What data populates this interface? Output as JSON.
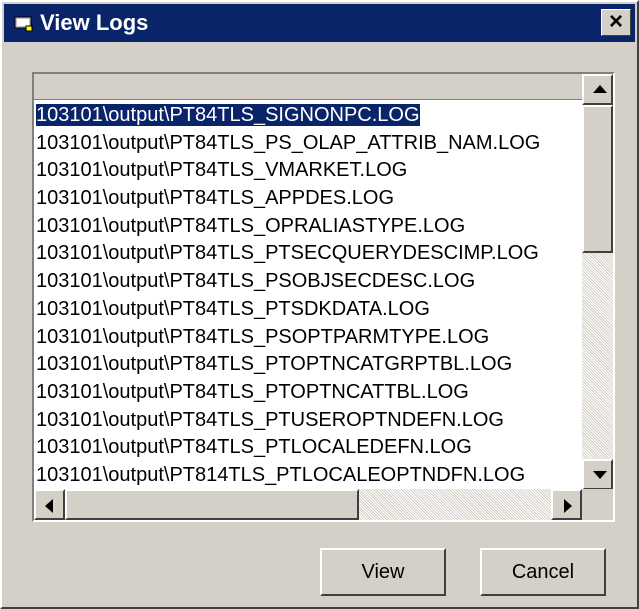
{
  "window": {
    "title": "View Logs",
    "close_label": "×"
  },
  "log_list": {
    "header": "",
    "items": [
      "103101\\output\\PT84TLS_SIGNONPC.LOG",
      "103101\\output\\PT84TLS_PS_OLAP_ATTRIB_NAM.LOG",
      "103101\\output\\PT84TLS_VMARKET.LOG",
      "103101\\output\\PT84TLS_APPDES.LOG",
      "103101\\output\\PT84TLS_OPRALIASTYPE.LOG",
      "103101\\output\\PT84TLS_PTSECQUERYDESCIMP.LOG",
      "103101\\output\\PT84TLS_PSOBJSECDESC.LOG",
      "103101\\output\\PT84TLS_PTSDKDATA.LOG",
      "103101\\output\\PT84TLS_PSOPTPARMTYPE.LOG",
      "103101\\output\\PT84TLS_PTOPTNCATGRPTBL.LOG",
      "103101\\output\\PT84TLS_PTOPTNCATTBL.LOG",
      "103101\\output\\PT84TLS_PTUSEROPTNDEFN.LOG",
      "103101\\output\\PT84TLS_PTLOCALEDEFN.LOG",
      "103101\\output\\PT814TLS_PTLOCALEOPTNDFN.LOG"
    ],
    "selected_index": 0
  },
  "buttons": {
    "view": "View",
    "cancel": "Cancel"
  },
  "colors": {
    "titlebar": "#0a246a",
    "face": "#d4d0c8",
    "selection": "#0a246a"
  }
}
